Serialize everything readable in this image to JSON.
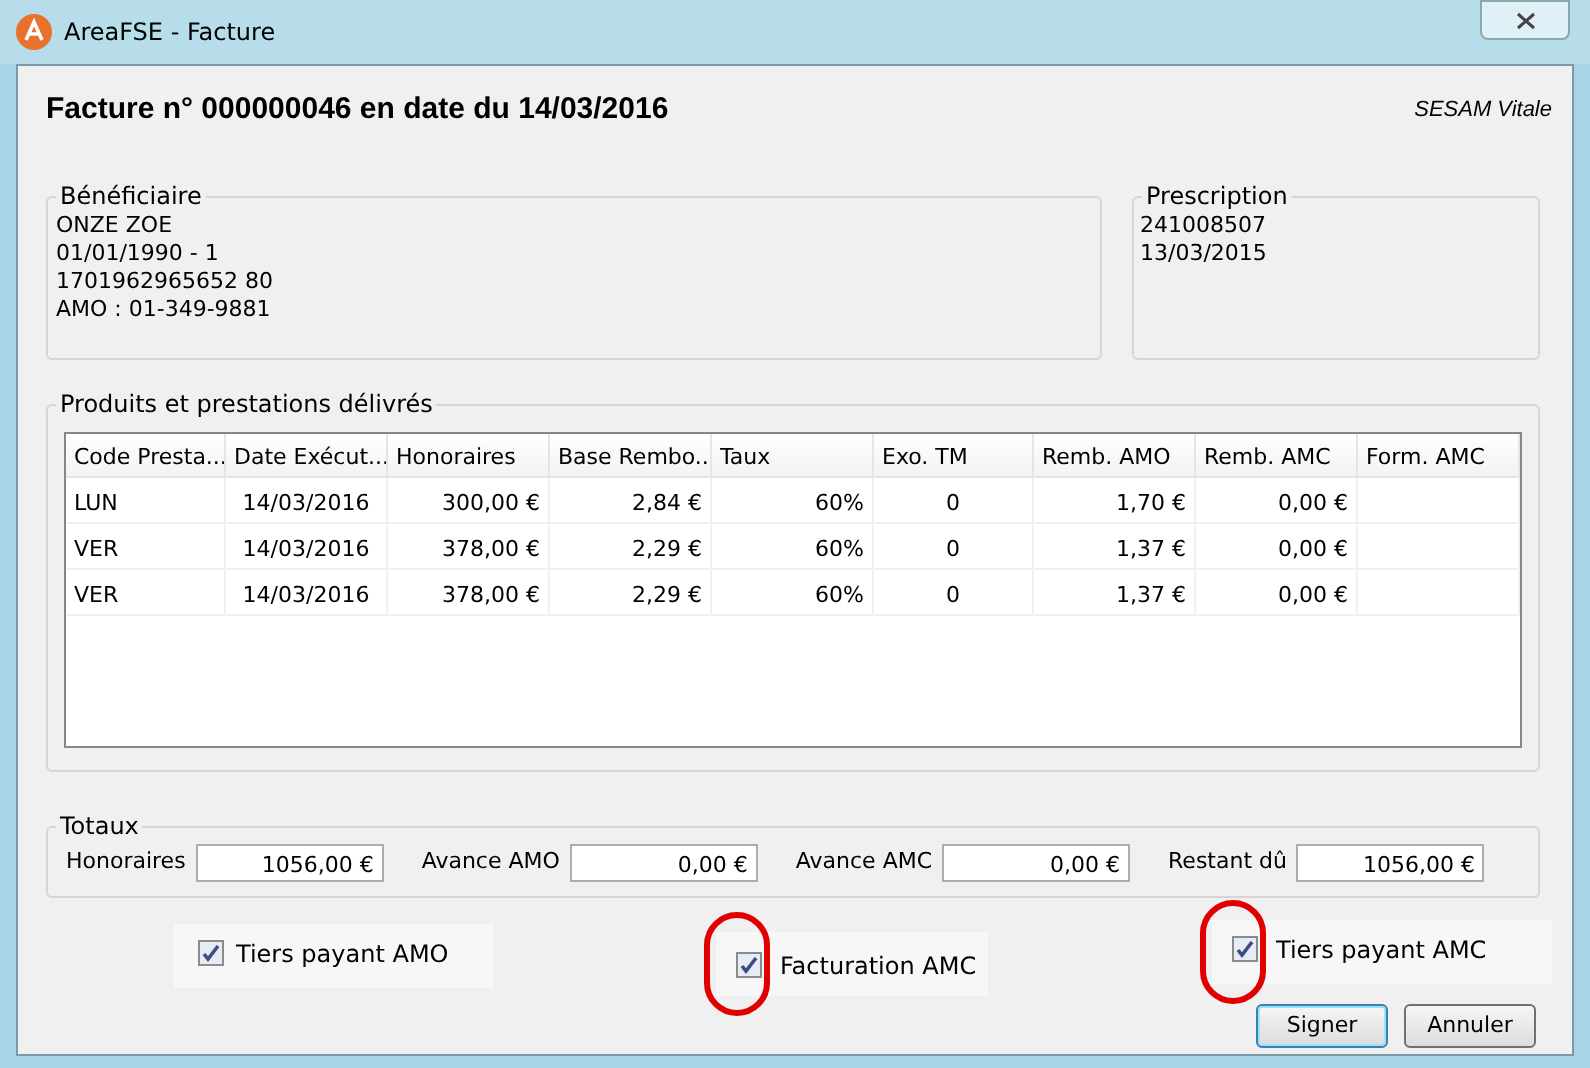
{
  "window": {
    "title": "AreaFSE - Facture"
  },
  "header": {
    "title": "Facture n° 000000046 en date du 14/03/2016",
    "mode": "SESAM Vitale"
  },
  "beneficiaire": {
    "legend": "Bénéficiaire",
    "lines": [
      "ONZE ZOE",
      "01/01/1990 - 1",
      "1701962965652 80",
      "AMO : 01-349-9881"
    ]
  },
  "prescription": {
    "legend": "Prescription",
    "lines": [
      "241008507",
      "13/03/2015"
    ]
  },
  "produits": {
    "legend": "Produits et prestations délivrés",
    "table": {
      "columns": [
        "Code Presta...",
        "Date Exécut...",
        "Honoraires",
        "Base Rembo...",
        "Taux",
        "Exo. TM",
        "Remb. AMO",
        "Remb. AMC",
        "Form. AMC"
      ],
      "rows": [
        [
          "LUN",
          "14/03/2016",
          "300,00 €",
          "2,84 €",
          "60%",
          "0",
          "1,70 €",
          "0,00 €"
        ],
        [
          "VER",
          "14/03/2016",
          "378,00 €",
          "2,29 €",
          "60%",
          "0",
          "1,37 €",
          "0,00 €"
        ],
        [
          "VER",
          "14/03/2016",
          "378,00 €",
          "2,29 €",
          "60%",
          "0",
          "1,37 €",
          "0,00 €"
        ]
      ]
    }
  },
  "totaux": {
    "legend": "Totaux",
    "fields": [
      {
        "label": "Honoraires",
        "value": "1056,00 €"
      },
      {
        "label": "Avance AMO",
        "value": "0,00 €"
      },
      {
        "label": "Avance AMC",
        "value": "0,00 €"
      },
      {
        "label": "Restant dû",
        "value": "1056,00 €"
      }
    ]
  },
  "options": [
    {
      "label": "Tiers payant AMO",
      "checked": true,
      "circled": false
    },
    {
      "label": "Facturation AMC",
      "checked": true,
      "circled": true
    },
    {
      "label": "Tiers payant AMC",
      "checked": true,
      "circled": true
    }
  ],
  "buttons": [
    {
      "label": "Signer",
      "default": true
    },
    {
      "label": "Annuler",
      "default": false
    }
  ]
}
